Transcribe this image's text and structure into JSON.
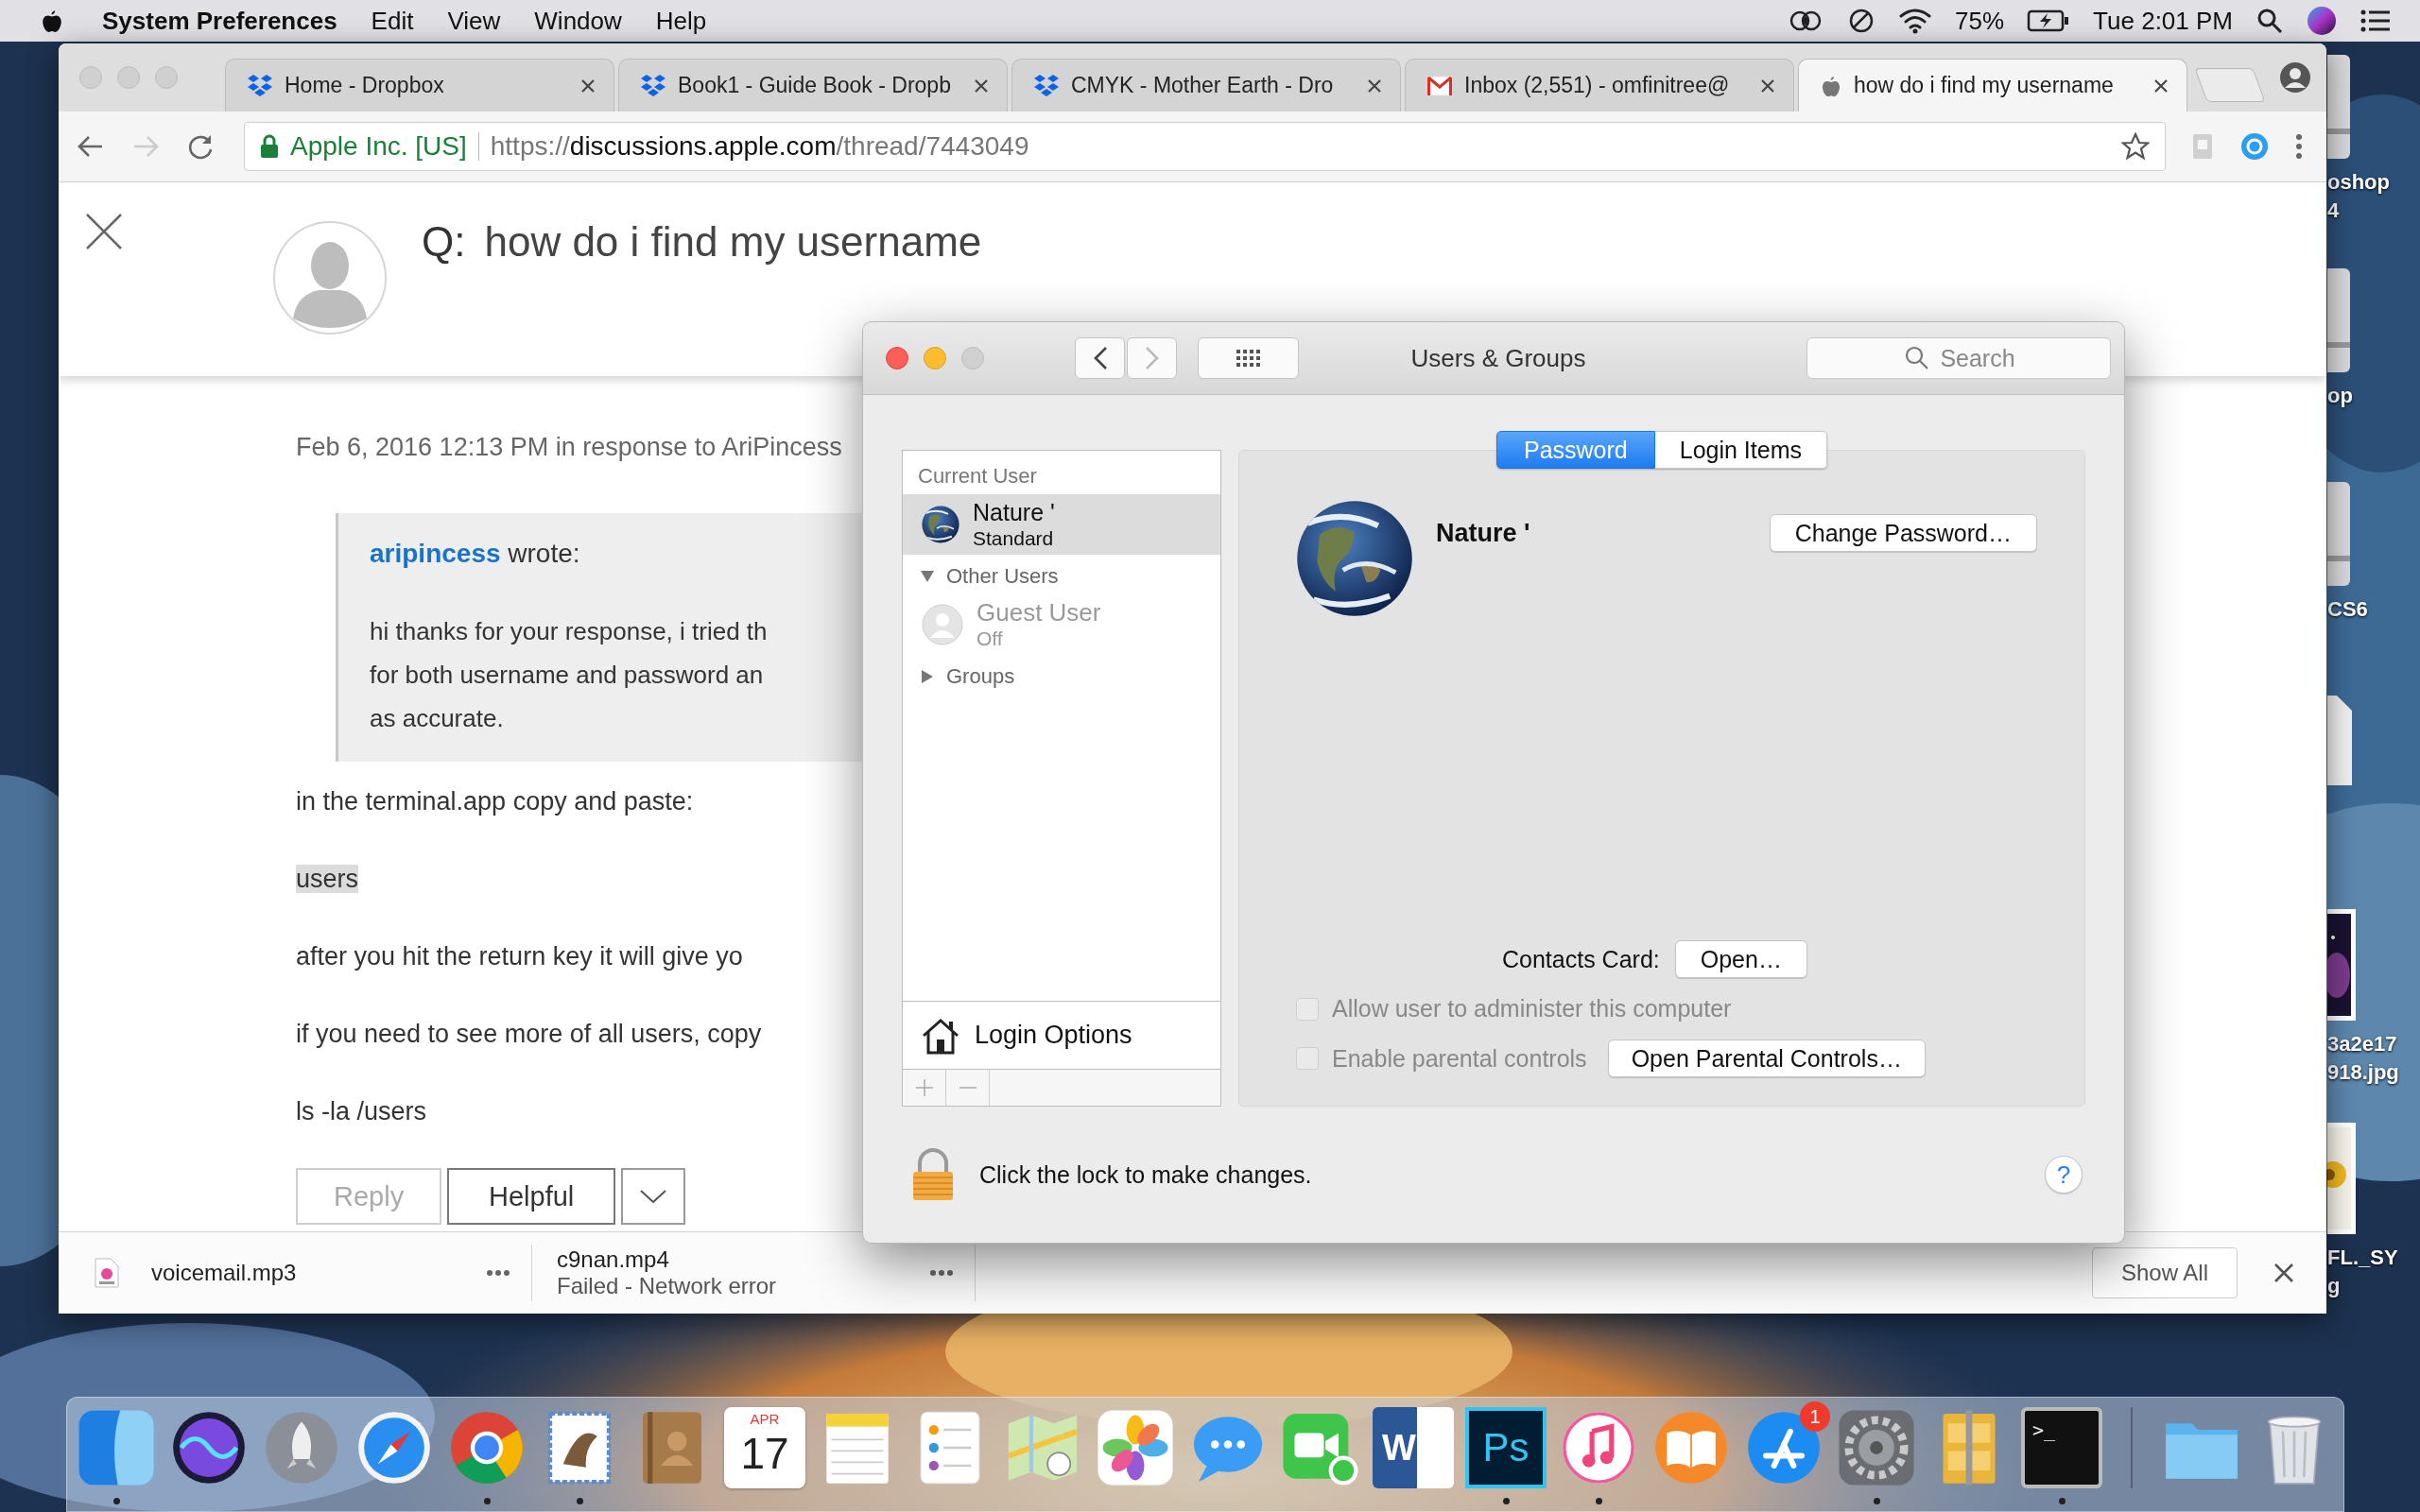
{
  "menu_bar": {
    "app_name": "System Preferences",
    "menus": [
      "Edit",
      "View",
      "Window",
      "Help"
    ],
    "battery_text": "75%",
    "clock": "Tue 2:01 PM"
  },
  "desktop_icons": [
    {
      "kind": "drive",
      "lines": [
        "oshop",
        "4"
      ]
    },
    {
      "kind": "drive",
      "lines": [
        "op"
      ]
    },
    {
      "kind": "drive",
      "lines": [
        "CS6"
      ]
    },
    {
      "kind": "document"
    },
    {
      "lines": [
        "3a2e17",
        "918.jpg"
      ]
    },
    {
      "lines": [
        "FL._SY",
        "g"
      ]
    }
  ],
  "browser": {
    "active": false,
    "tabs": [
      {
        "kind": "diamonds",
        "title": "Home - Dropbox",
        "selected": false
      },
      {
        "kind": "diamonds",
        "title": "Book1 - Guide Book - Dropb",
        "selected": false
      },
      {
        "kind": "diamonds",
        "title": "CMYK - Mother Earth - Dro",
        "selected": false
      },
      {
        "kind": "envelope",
        "title": "Inbox (2,551) - omfinitree@",
        "selected": false
      },
      {
        "kind": "apple",
        "title": "how do i find my username",
        "selected": true
      }
    ],
    "navigation": {
      "back_enabled": true,
      "forward_enabled": false
    },
    "address": {
      "identity": "Apple Inc. [US]",
      "scheme": "https://",
      "host": "discussions.apple.com",
      "path": "/thread/7443049"
    },
    "page": {
      "question_prefix": "Q:",
      "question": "how do i find my username",
      "reply_meta": "Feb 6, 2016 12:13 PM in response to AriPincess",
      "quote": {
        "author": "aripincess",
        "verb": "wrote:",
        "lines": [
          "hi thanks for your response, i tried th",
          "for both username and password an",
          "as accurate."
        ]
      },
      "paragraphs": [
        {
          "kind": "text",
          "text": "in the terminal.app copy and paste:"
        },
        {
          "kind": "code",
          "text": "users"
        },
        {
          "kind": "text",
          "text": "after you hit the return key it will give yo"
        },
        {
          "kind": "text",
          "text": "if you need to see more of all users, copy"
        },
        {
          "kind": "text",
          "text": "ls -la /users"
        }
      ],
      "actions": [
        {
          "label": "Reply",
          "disabled": true
        },
        {
          "label": "Helpful",
          "disabled": false
        }
      ]
    },
    "downloads": {
      "items": [
        {
          "kind": "audio",
          "name": "voicemail.mp3"
        },
        {
          "kind": "failed",
          "name": "c9nan.mp4",
          "status": "Failed - Network error"
        }
      ],
      "show_all": "Show All"
    }
  },
  "dialog": {
    "title": "Users & Groups",
    "search_placeholder": "Search",
    "back_enabled": true,
    "forward_enabled": false,
    "sidebar": {
      "header": "Current User",
      "current_user": {
        "name": "Nature '",
        "role": "Standard",
        "selected": true
      },
      "groups": [
        {
          "label": "Other Users",
          "expanded": true,
          "children": [
            {
              "name": "Guest User",
              "role": "Off",
              "selected": false,
              "disabled": true
            }
          ]
        },
        {
          "label": "Groups",
          "expanded": false
        }
      ],
      "login_options": "Login Options"
    },
    "tabs": [
      {
        "label": "Password",
        "selected": true
      },
      {
        "label": "Login Items",
        "selected": false
      }
    ],
    "panel": {
      "user_name": "Nature '",
      "change_password": "Change Password…",
      "contacts_label": "Contacts Card:",
      "contacts_button": "Open…",
      "options": [
        {
          "label": "Allow user to administer this computer",
          "checked": false,
          "disabled": true
        },
        {
          "label": "Enable parental controls",
          "checked": false,
          "disabled": true,
          "button": "Open Parental Controls…"
        }
      ]
    },
    "locked": true,
    "lock_message": "Click the lock to make changes.",
    "help": "?"
  },
  "dock": [
    {
      "kind": "finder",
      "running": true
    },
    {
      "kind": "orb",
      "running": false
    },
    {
      "kind": "rocket",
      "running": false
    },
    {
      "kind": "compass",
      "running": false
    },
    {
      "kind": "ring",
      "running": true
    },
    {
      "kind": "stamp",
      "running": true
    },
    {
      "kind": "addressbook",
      "running": false
    },
    {
      "kind": "calendar",
      "month": "APR",
      "day": "17",
      "running": false
    },
    {
      "kind": "notepad",
      "running": false
    },
    {
      "kind": "checklist",
      "running": false
    },
    {
      "kind": "map",
      "running": false
    },
    {
      "kind": "flower",
      "running": false
    },
    {
      "kind": "speech",
      "running": false
    },
    {
      "kind": "videocall",
      "running": false
    },
    {
      "kind": "wordtile",
      "glyph": "W",
      "running": false
    },
    {
      "kind": "pstile",
      "glyph": "Ps",
      "running": true
    },
    {
      "kind": "music",
      "running": true
    },
    {
      "kind": "book",
      "running": false
    },
    {
      "kind": "store",
      "badge": "1",
      "running": false
    },
    {
      "kind": "gear",
      "running": true
    },
    {
      "kind": "archive",
      "running": false
    },
    {
      "kind": "terminal",
      "glyph": ">_",
      "running": true
    },
    {
      "kind": "separator"
    },
    {
      "kind": "folder",
      "running": false
    },
    {
      "kind": "trash",
      "running": false
    }
  ]
}
